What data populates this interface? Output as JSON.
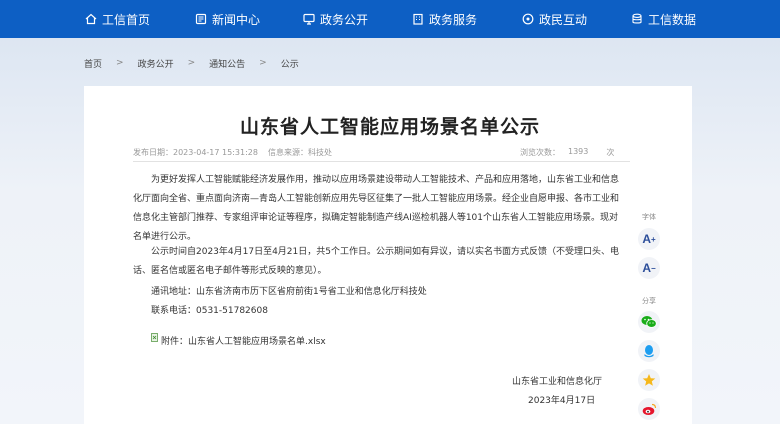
{
  "nav": {
    "items": [
      {
        "label": "工信首页",
        "icon": "home-icon"
      },
      {
        "label": "新闻中心",
        "icon": "news-icon"
      },
      {
        "label": "政务公开",
        "icon": "monitor-icon"
      },
      {
        "label": "政务服务",
        "icon": "building-icon"
      },
      {
        "label": "政民互动",
        "icon": "chat-icon"
      },
      {
        "label": "工信数据",
        "icon": "database-icon"
      }
    ]
  },
  "breadcrumb": [
    "首页",
    "政务公开",
    "通知公告",
    "公示"
  ],
  "article": {
    "title": "山东省人工智能应用场景名单公示",
    "publish_date": "发布日期：2023-04-17 15:31:28",
    "source": "信息来源：科技处",
    "views_label": "浏览次数：",
    "views": "1393",
    "views_unit": "次",
    "para1": "为更好发挥人工智能赋能经济发展作用，推动以应用场景建设带动人工智能技术、产品和应用落地，山东省工业和信息化厅面向全省、重点面向济南—青岛人工智能创新应用先导区征集了一批人工智能应用场景。经企业自愿申报、各市工业和信息化主管部门推荐、专家组评审论证等程序，拟确定智能制造产线AI巡检机器人等101个山东省人工智能应用场景。现对名单进行公示。",
    "para2": "公示时间自2023年4月17日至4月21日，共5个工作日。公示期间如有异议，请以实名书面方式反馈（不受理口头、电话、匿名信或匿名电子邮件等形式反映的意见）。",
    "address": "通讯地址：山东省济南市历下区省府前街1号省工业和信息化厅科技处",
    "phone": "联系电话：0531-51782608",
    "attachment": "附件：山东省人工智能应用场景名单.xlsx",
    "signer": "山东省工业和信息化厅",
    "sign_date": "2023年4月17日"
  },
  "side": {
    "font_label": "字体",
    "font_increase": "A",
    "font_decrease": "A",
    "share_label": "分享"
  }
}
